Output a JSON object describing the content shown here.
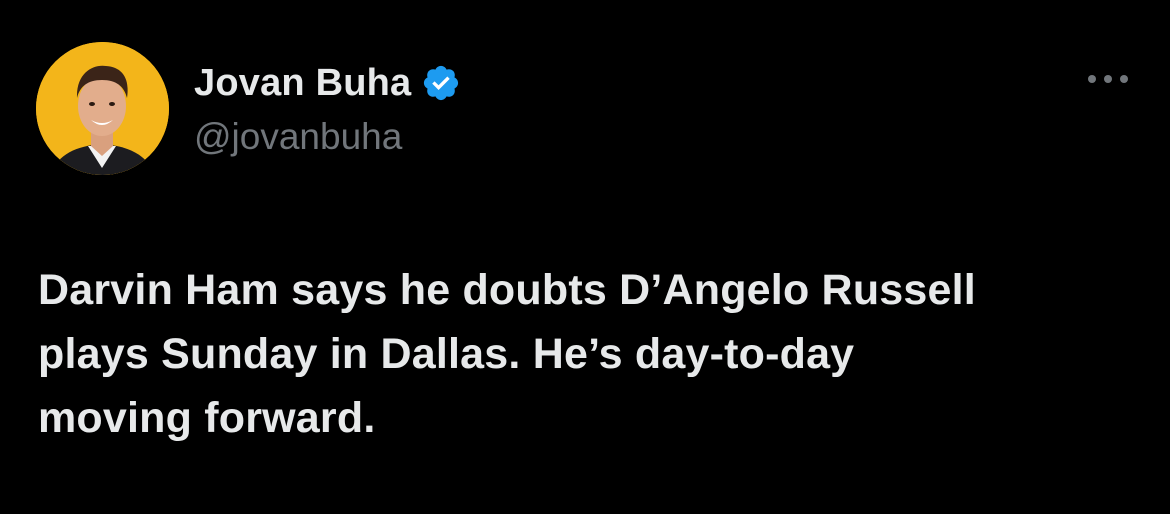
{
  "tweet": {
    "author": {
      "display_name": "Jovan Buha",
      "handle": "@jovanbuha",
      "verified": true
    },
    "text": "Darvin Ham says he doubts D’Angelo Russell\nplays Sunday in Dallas. He’s day-to-day\nmoving forward."
  },
  "icons": {
    "verified": "verified-badge-icon",
    "more": "more-options-icon"
  },
  "colors": {
    "background": "#000000",
    "primary_text": "#e7e9ea",
    "secondary_text": "#71767b",
    "verified_blue": "#1d9bf0",
    "avatar_background": "#f3b51a"
  }
}
